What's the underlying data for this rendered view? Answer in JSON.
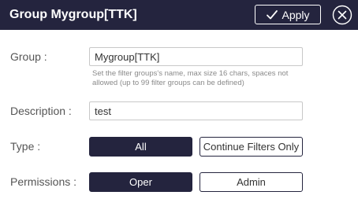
{
  "header": {
    "title": "Group Mygroup[TTK]",
    "apply_label": "Apply",
    "apply_icon": "check-icon",
    "close_icon": "close-circle-icon"
  },
  "form": {
    "group": {
      "label": "Group :",
      "value": "Mygroup[TTK]",
      "hint": "Set the filter groups's name, max size 16 chars, spaces not allowed (up to 99 filter groups can be defined)"
    },
    "description": {
      "label": "Description :",
      "value": "test"
    },
    "type": {
      "label": "Type :",
      "options": [
        "All",
        "Continue Filters Only"
      ],
      "selected": "All"
    },
    "permissions": {
      "label": "Permissions :",
      "options": [
        "Oper",
        "Admin"
      ],
      "selected": "Oper"
    }
  },
  "colors": {
    "header_bg": "#24243e",
    "selected_bg": "#24243e"
  }
}
